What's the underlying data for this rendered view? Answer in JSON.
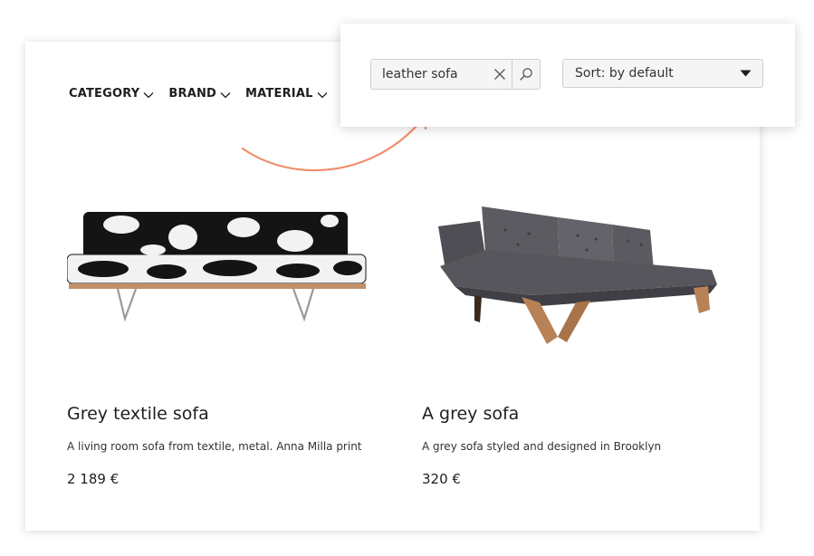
{
  "filters": [
    {
      "label": "CATEGORY"
    },
    {
      "label": "BRAND"
    },
    {
      "label": "MATERIAL"
    }
  ],
  "search": {
    "value": "leather sofa"
  },
  "sort": {
    "selected": "Sort: by default"
  },
  "products": [
    {
      "title": "Grey textile sofa",
      "description": "A living room sofa from textile, metal. Anna Milla print",
      "price": "2 189 €"
    },
    {
      "title": "A grey sofa",
      "description": "A grey sofa styled and designed in Brooklyn",
      "price": "320 €"
    }
  ],
  "colors": {
    "accent_arrow": "#f0906c"
  }
}
